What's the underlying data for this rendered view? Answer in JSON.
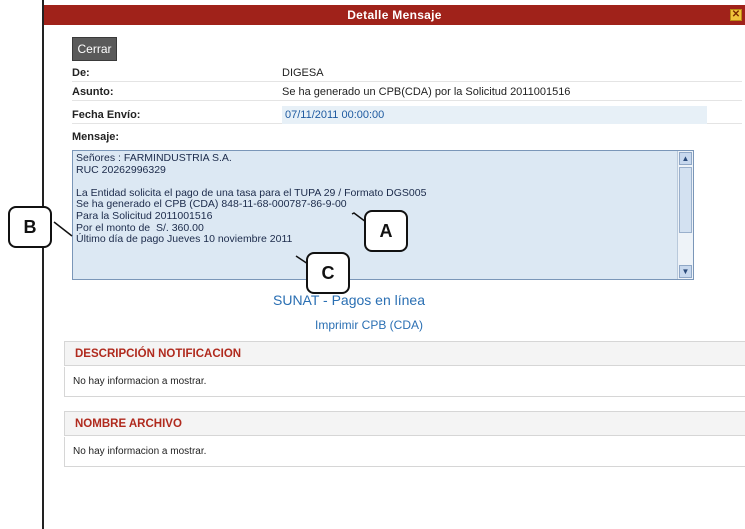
{
  "window": {
    "title": "Detalle Mensaje",
    "close_glyph": "✕"
  },
  "toolbar": {
    "close_label": "Cerrar"
  },
  "fields": {
    "de_label": "De:",
    "de_value": "DIGESA",
    "asunto_label": "Asunto:",
    "asunto_value": "Se ha generado un CPB(CDA) por la Solicitud 2011001516",
    "fecha_label": "Fecha Envío:",
    "fecha_value": "07/11/2011 00:00:00",
    "mensaje_label": "Mensaje:"
  },
  "message": {
    "text": "Señores : FARMINDUSTRIA S.A.\nRUC 20262996329\n\nLa Entidad solicita el pago de una tasa para el TUPA 29 / Formato DGS005\nSe ha generado el CPB (CDA) 848-11-68-000787-86-9-00\nPara la Solicitud 2011001516\nPor el monto de  S/. 360.00\nÚltimo día de pago Jueves 10 noviembre 2011"
  },
  "links": {
    "sunat": "SUNAT - Pagos en línea",
    "print": "Imprimir CPB (CDA)"
  },
  "sections": [
    {
      "header": "DESCRIPCIÓN NOTIFICACION",
      "body": "No hay informacion a mostrar."
    },
    {
      "header": "NOMBRE ARCHIVO",
      "body": "No hay informacion a mostrar."
    }
  ],
  "callouts": {
    "a": "A",
    "b": "B",
    "c": "C"
  },
  "colors": {
    "titlebar": "#a0221a",
    "section_header_text": "#b02a1e",
    "link": "#2a6fb3",
    "message_bg": "#dce8f3"
  }
}
